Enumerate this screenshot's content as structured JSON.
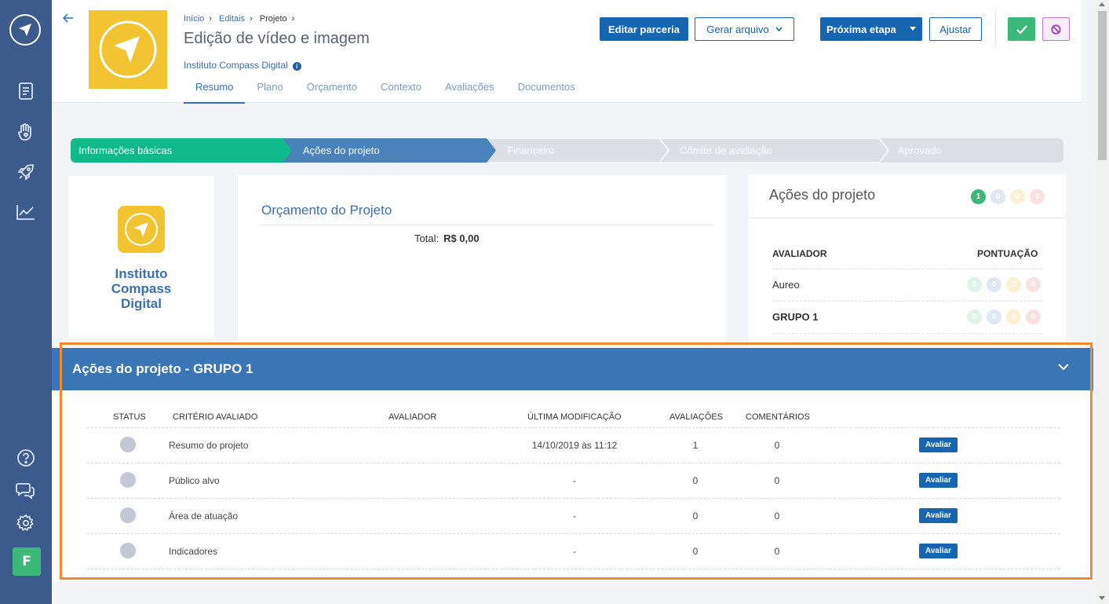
{
  "header": {
    "back_icon": "arrow-left-icon",
    "breadcrumb": {
      "home": "Início",
      "editais": "Editais",
      "current": "Projeto"
    },
    "title": "Edição de vídeo e imagem",
    "organization": "Instituto Compass Digital",
    "tabs": [
      {
        "label": "Resumo",
        "active": true
      },
      {
        "label": "Plano"
      },
      {
        "label": "Orçamento"
      },
      {
        "label": "Contexto"
      },
      {
        "label": "Avaliações"
      },
      {
        "label": "Documentos"
      }
    ],
    "buttons": {
      "edit": "Editar parceria",
      "generate": "Gerar arquivo",
      "next": "Próxima etapa",
      "adjust": "Ajustar",
      "approve_icon": "check-icon",
      "block_icon": "ban-icon"
    }
  },
  "steps": [
    {
      "label": "Informações básicas",
      "state": "done"
    },
    {
      "label": "Ações do projeto",
      "state": "current"
    },
    {
      "label": "Financeiro",
      "state": "pending"
    },
    {
      "label": "Cômite de avaliação",
      "state": "pending"
    },
    {
      "label": "Aprovado",
      "state": "pending"
    }
  ],
  "org_card": {
    "name": "Instituto Compass Digital"
  },
  "budget": {
    "title": "Orçamento do Projeto",
    "total_label": "Total:",
    "total_value": "R$ 0,00"
  },
  "actions_card": {
    "title": "Ações do projeto",
    "counts": [
      "1",
      "0",
      "0",
      "0"
    ],
    "col_evaluator": "AVALIADOR",
    "col_score": "PONTUAÇÃO",
    "rows": [
      {
        "name": "Aureo",
        "scores": [
          "0",
          "0",
          "0",
          "0"
        ]
      },
      {
        "name": "GRUPO 1",
        "scores": [
          "0",
          "0",
          "0",
          "0"
        ]
      }
    ]
  },
  "group": {
    "title": "Ações do projeto - GRUPO 1",
    "columns": {
      "status": "STATUS",
      "criterion": "CRITÉRIO AVALIADO",
      "evaluator": "AVALIADOR",
      "modified": "ÚLTIMA MODIFICAÇÃO",
      "evaluations": "AVALIAÇÕES",
      "comments": "COMENTÁRIOS"
    },
    "rows": [
      {
        "criterion": "Resumo do projeto",
        "evaluator": "",
        "modified": "14/10/2019 às 11:12",
        "evaluations": "1",
        "comments": "0",
        "action": "Avaliar"
      },
      {
        "criterion": "Público alvo",
        "evaluator": "",
        "modified": "-",
        "evaluations": "0",
        "comments": "0",
        "action": "Avaliar"
      },
      {
        "criterion": "Área de atuação",
        "evaluator": "",
        "modified": "-",
        "evaluations": "0",
        "comments": "0",
        "action": "Avaliar"
      },
      {
        "criterion": "Indicadores",
        "evaluator": "",
        "modified": "-",
        "evaluations": "0",
        "comments": "0",
        "action": "Avaliar"
      }
    ]
  },
  "sidebar": {
    "avatar_letter": "F",
    "icons": [
      "logo-icon",
      "document-icon",
      "hand-heart-icon",
      "rocket-icon",
      "chart-icon",
      "help-icon",
      "chat-icon",
      "gear-icon"
    ]
  },
  "colors": {
    "sidebar": "#3b5b8c",
    "primary": "#1565b0",
    "success": "#3cb878",
    "step_current": "#4a82bb",
    "highlight_frame": "#f08a2d"
  }
}
